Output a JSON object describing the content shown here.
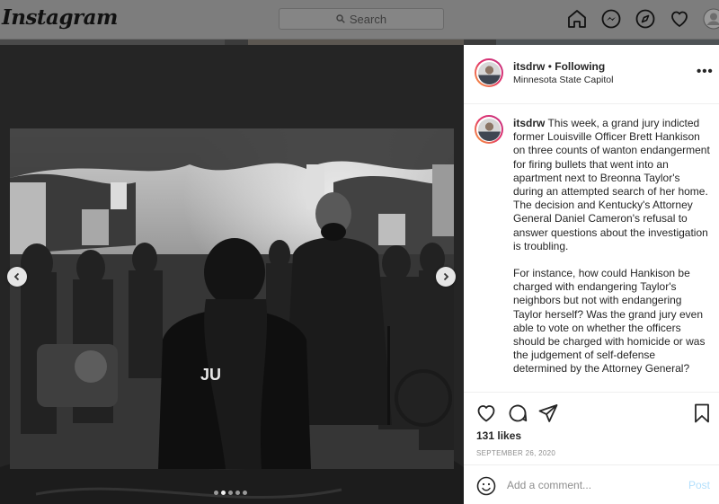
{
  "app": {
    "logo": "Instagram"
  },
  "search": {
    "placeholder": "Search"
  },
  "nav": {
    "icons": [
      "home-icon",
      "messenger-icon",
      "explore-icon",
      "heart-icon",
      "profile-avatar"
    ]
  },
  "post": {
    "username": "itsdrw",
    "follow_status": "Following",
    "separator": "•",
    "location": "Minnesota State Capitol",
    "caption_paragraphs": [
      "This week, a grand jury indicted former Louisville Officer Brett Hankison on three counts of wanton endangerment for firing bullets that went into an apartment next to Breonna Taylor's during an attempted search of her home. The decision and Kentucky's Attorney General Daniel Cameron's refusal to answer questions about the investigation is troubling.",
      "For instance, how could Hankison be charged with endangering Taylor's neighbors but not with endangering Taylor herself? Was the grand jury even able to vote on whether the officers should be charged with homicide or was the judgement of self-defense determined by the Attorney General?"
    ],
    "likes": "131 likes",
    "date": "SEPTEMBER 26, 2020",
    "carousel": {
      "slide_count": 5,
      "current_index": 1
    }
  },
  "comment": {
    "placeholder": "Add a comment...",
    "post_label": "Post"
  },
  "colors": {
    "accent_blue": "#0095f6",
    "post_disabled": "#b2dffc",
    "meta_gray": "#8e8e8e"
  }
}
